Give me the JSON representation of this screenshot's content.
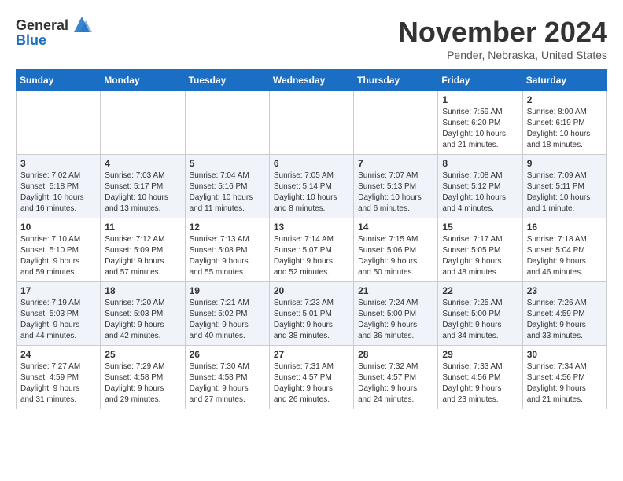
{
  "header": {
    "logo_line1": "General",
    "logo_line2": "Blue",
    "month_year": "November 2024",
    "location": "Pender, Nebraska, United States"
  },
  "weekdays": [
    "Sunday",
    "Monday",
    "Tuesday",
    "Wednesday",
    "Thursday",
    "Friday",
    "Saturday"
  ],
  "weeks": [
    [
      {
        "day": "",
        "info": ""
      },
      {
        "day": "",
        "info": ""
      },
      {
        "day": "",
        "info": ""
      },
      {
        "day": "",
        "info": ""
      },
      {
        "day": "",
        "info": ""
      },
      {
        "day": "1",
        "info": "Sunrise: 7:59 AM\nSunset: 6:20 PM\nDaylight: 10 hours\nand 21 minutes."
      },
      {
        "day": "2",
        "info": "Sunrise: 8:00 AM\nSunset: 6:19 PM\nDaylight: 10 hours\nand 18 minutes."
      }
    ],
    [
      {
        "day": "3",
        "info": "Sunrise: 7:02 AM\nSunset: 5:18 PM\nDaylight: 10 hours\nand 16 minutes."
      },
      {
        "day": "4",
        "info": "Sunrise: 7:03 AM\nSunset: 5:17 PM\nDaylight: 10 hours\nand 13 minutes."
      },
      {
        "day": "5",
        "info": "Sunrise: 7:04 AM\nSunset: 5:16 PM\nDaylight: 10 hours\nand 11 minutes."
      },
      {
        "day": "6",
        "info": "Sunrise: 7:05 AM\nSunset: 5:14 PM\nDaylight: 10 hours\nand 8 minutes."
      },
      {
        "day": "7",
        "info": "Sunrise: 7:07 AM\nSunset: 5:13 PM\nDaylight: 10 hours\nand 6 minutes."
      },
      {
        "day": "8",
        "info": "Sunrise: 7:08 AM\nSunset: 5:12 PM\nDaylight: 10 hours\nand 4 minutes."
      },
      {
        "day": "9",
        "info": "Sunrise: 7:09 AM\nSunset: 5:11 PM\nDaylight: 10 hours\nand 1 minute."
      }
    ],
    [
      {
        "day": "10",
        "info": "Sunrise: 7:10 AM\nSunset: 5:10 PM\nDaylight: 9 hours\nand 59 minutes."
      },
      {
        "day": "11",
        "info": "Sunrise: 7:12 AM\nSunset: 5:09 PM\nDaylight: 9 hours\nand 57 minutes."
      },
      {
        "day": "12",
        "info": "Sunrise: 7:13 AM\nSunset: 5:08 PM\nDaylight: 9 hours\nand 55 minutes."
      },
      {
        "day": "13",
        "info": "Sunrise: 7:14 AM\nSunset: 5:07 PM\nDaylight: 9 hours\nand 52 minutes."
      },
      {
        "day": "14",
        "info": "Sunrise: 7:15 AM\nSunset: 5:06 PM\nDaylight: 9 hours\nand 50 minutes."
      },
      {
        "day": "15",
        "info": "Sunrise: 7:17 AM\nSunset: 5:05 PM\nDaylight: 9 hours\nand 48 minutes."
      },
      {
        "day": "16",
        "info": "Sunrise: 7:18 AM\nSunset: 5:04 PM\nDaylight: 9 hours\nand 46 minutes."
      }
    ],
    [
      {
        "day": "17",
        "info": "Sunrise: 7:19 AM\nSunset: 5:03 PM\nDaylight: 9 hours\nand 44 minutes."
      },
      {
        "day": "18",
        "info": "Sunrise: 7:20 AM\nSunset: 5:03 PM\nDaylight: 9 hours\nand 42 minutes."
      },
      {
        "day": "19",
        "info": "Sunrise: 7:21 AM\nSunset: 5:02 PM\nDaylight: 9 hours\nand 40 minutes."
      },
      {
        "day": "20",
        "info": "Sunrise: 7:23 AM\nSunset: 5:01 PM\nDaylight: 9 hours\nand 38 minutes."
      },
      {
        "day": "21",
        "info": "Sunrise: 7:24 AM\nSunset: 5:00 PM\nDaylight: 9 hours\nand 36 minutes."
      },
      {
        "day": "22",
        "info": "Sunrise: 7:25 AM\nSunset: 5:00 PM\nDaylight: 9 hours\nand 34 minutes."
      },
      {
        "day": "23",
        "info": "Sunrise: 7:26 AM\nSunset: 4:59 PM\nDaylight: 9 hours\nand 33 minutes."
      }
    ],
    [
      {
        "day": "24",
        "info": "Sunrise: 7:27 AM\nSunset: 4:59 PM\nDaylight: 9 hours\nand 31 minutes."
      },
      {
        "day": "25",
        "info": "Sunrise: 7:29 AM\nSunset: 4:58 PM\nDaylight: 9 hours\nand 29 minutes."
      },
      {
        "day": "26",
        "info": "Sunrise: 7:30 AM\nSunset: 4:58 PM\nDaylight: 9 hours\nand 27 minutes."
      },
      {
        "day": "27",
        "info": "Sunrise: 7:31 AM\nSunset: 4:57 PM\nDaylight: 9 hours\nand 26 minutes."
      },
      {
        "day": "28",
        "info": "Sunrise: 7:32 AM\nSunset: 4:57 PM\nDaylight: 9 hours\nand 24 minutes."
      },
      {
        "day": "29",
        "info": "Sunrise: 7:33 AM\nSunset: 4:56 PM\nDaylight: 9 hours\nand 23 minutes."
      },
      {
        "day": "30",
        "info": "Sunrise: 7:34 AM\nSunset: 4:56 PM\nDaylight: 9 hours\nand 21 minutes."
      }
    ]
  ]
}
